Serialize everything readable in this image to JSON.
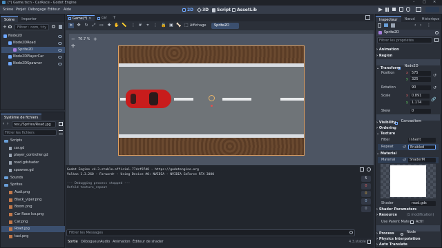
{
  "window": {
    "title": "(*) Game.tscn - CarRace - Godot Engine"
  },
  "menu": {
    "items": [
      "Scène",
      "Projet",
      "Débogage",
      "Éditeur",
      "Aide"
    ]
  },
  "workspaces": {
    "w2d": "2D",
    "w3d": "3D",
    "script": "Script",
    "assetlib": "AssetLib"
  },
  "scene_panel": {
    "tabs": [
      "Scène",
      "Importer"
    ],
    "filter_placeholder": "Filtrer : nom, t:ty",
    "tree": [
      {
        "label": "Node2D",
        "indent": 0,
        "color": "#6fa8ff",
        "selected": false
      },
      {
        "label": "Node2DRoad",
        "indent": 1,
        "color": "#6fa8ff",
        "selected": false
      },
      {
        "label": "Sprite2D",
        "indent": 2,
        "color": "#a57ddb",
        "selected": true
      },
      {
        "label": "Node2DPlayerCar",
        "indent": 1,
        "color": "#6fa8ff",
        "selected": false
      },
      {
        "label": "Node2DSpawner",
        "indent": 1,
        "color": "#6fa8ff",
        "selected": false
      }
    ]
  },
  "filesystem": {
    "title": "Système de fichiers",
    "path": "res://Sprites/Road.jpg",
    "filter_placeholder": "Filtrer les fichiers",
    "items": [
      {
        "label": "Scripts",
        "type": "folder",
        "indent": 0
      },
      {
        "label": "car.gd",
        "type": "file",
        "indent": 1
      },
      {
        "label": "player_controller.gd",
        "type": "file",
        "indent": 1
      },
      {
        "label": "road.gdshader",
        "type": "file",
        "indent": 1
      },
      {
        "label": "spawner.gd",
        "type": "file",
        "indent": 1
      },
      {
        "label": "Sounds",
        "type": "folder",
        "indent": 0
      },
      {
        "label": "Sprites",
        "type": "folder",
        "indent": 0
      },
      {
        "label": "Audi.png",
        "type": "img",
        "indent": 1
      },
      {
        "label": "Black_viper.png",
        "type": "img",
        "indent": 1
      },
      {
        "label": "Boom.png",
        "type": "img",
        "indent": 1
      },
      {
        "label": "Car Race Ico.png",
        "type": "img",
        "indent": 1
      },
      {
        "label": "Car.png",
        "type": "img",
        "indent": 1
      },
      {
        "label": "Road.jpg",
        "type": "img",
        "indent": 1,
        "selected": true
      },
      {
        "label": "taxi.png",
        "type": "img",
        "indent": 1
      }
    ]
  },
  "editor_tabs": [
    "Game(*)",
    "car"
  ],
  "viewport_toolbar": {
    "display_label": "Affichage",
    "node_label": "Sprite2D"
  },
  "viewport": {
    "zoom": "70.7 %"
  },
  "output": {
    "lines": [
      {
        "text": "Godot Engine v4.3.stable.official.77dcf97d8 - https://godotengine.org",
        "color": "#d5dae2"
      },
      {
        "text": "Vulkan 1.3.260 - Forward+ - Using Device #0: NVIDIA - NVIDIA GeForce RTX 3080",
        "color": "#d5dae2"
      },
      {
        "text": "",
        "color": "#d5dae2"
      },
      {
        "text": "--- Debugging process stopped ---",
        "color": "#9ba4b0"
      },
      {
        "text": "Unfold texture_repeat",
        "color": "#9ba4b0"
      }
    ],
    "filter_placeholder": "Filtrer les Messages",
    "counts": [
      "5",
      "0",
      "0",
      "0",
      "0"
    ]
  },
  "bottom_tabs": [
    "Sortie",
    "Débogueur",
    "Audio",
    "Animation",
    "Éditeur de shader"
  ],
  "version": "4.3.stable",
  "inspector": {
    "tabs": [
      "Inspecteur",
      "Nœud",
      "Historique"
    ],
    "node_name": "Sprite2D",
    "filter_placeholder": "Filtrer les propriétés",
    "animation_label": "Animation",
    "region_label": "Region",
    "class_header": "Node2D",
    "transform_label": "Transform",
    "position_label": "Position",
    "position_x": "575",
    "position_y": "325",
    "rotation_label": "Rotation",
    "rotation_value": "90",
    "scale_label": "Scale",
    "scale_x": "0.891",
    "scale_y": "1.174",
    "skew_label": "Skew",
    "skew_value": "0",
    "canvasitem_header": "CanvasItem",
    "visibility_label": "Visibility",
    "ordering_label": "Ordering",
    "texture_label": "Texture",
    "filter_label": "Filter",
    "filter_value": "Inherit",
    "repeat_label": "Repeat",
    "repeat_value": "Enabled",
    "material_label": "Material",
    "material_prop": "Material",
    "material_value": "ShaderM",
    "shader_label": "Shader",
    "shader_value": "road.gds",
    "shader_params": "Shader Parameters",
    "resource_label": "Resource",
    "resource_value": "(1 modification)",
    "use_parent_label": "Use Parent Mate",
    "use_parent_value": "Actif",
    "node_header": "Node",
    "process_label": "Process",
    "physics_label": "Physics Interpolation",
    "auto_translate_label": "Auto Translate"
  }
}
